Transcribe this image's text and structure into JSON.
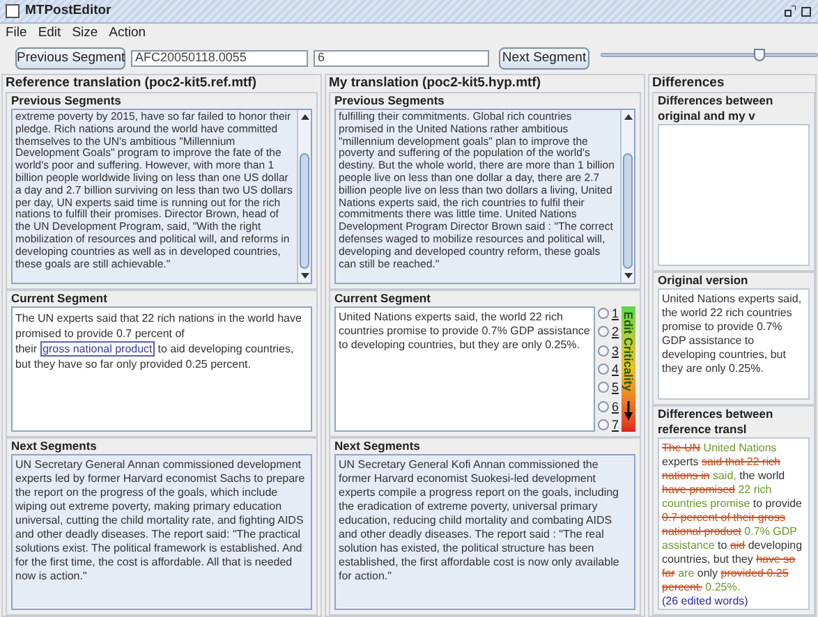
{
  "window": {
    "title": "MTPostEditor"
  },
  "menu": [
    "File",
    "Edit",
    "Size",
    "Action"
  ],
  "toolbar": {
    "previous_button": "Previous Segment",
    "document_field": "AFC20050118.0055",
    "segment_field": "6",
    "next_button": "Next Segment",
    "slider": {
      "level": 0.73
    }
  },
  "reference": {
    "title": "Reference translation (poc2-kit5.ref.mtf)",
    "previous": {
      "title": "Previous Segments",
      "text": "extreme poverty by 2015, have so far failed to honor their pledge. Rich nations around the world have committed themselves to the UN's ambitious \"Millennium Development Goals\" program to improve the fate of the world's poor and suffering. However, with more than 1 billion people worldwide living on less than one US dollar a day and 2.7 billion surviving on less than two US dollars per day, UN experts said time is running out for the rich nations to fulfill their promises. Director Brown, head of the UN Development Program, said, \"With the right mobilization of resources and political will, and reforms in developing countries as well as in developed countries, these goals are still achievable.\""
    },
    "current": {
      "title": "Current Segment",
      "parts": [
        {
          "text": "The UN experts said that 22 rich nations in the world have promised to provide 0.7 percent of their",
          "highlighted": false
        },
        {
          "text": "gross national product",
          "highlighted": true
        },
        {
          "text": "to aid developing countries, but they have so far only provided 0.25 percent.",
          "highlighted": false
        }
      ]
    },
    "next": {
      "title": "Next Segments",
      "text": "UN Secretary General Annan commissioned development experts led by former Harvard economist Sachs to prepare the report on the progress of the goals, which include wiping out extreme poverty, making primary education universal, cutting the child mortality rate, and fighting AIDS and other deadly diseases. The report said: \"The practical solutions exist. The political framework is established. And for the first time, the cost is affordable. All that is needed now is action.\""
    }
  },
  "translation": {
    "title": "My translation (poc2-kit5.hyp.mtf)",
    "previous": {
      "title": "Previous Segments",
      "text": "fulfilling their commitments. Global rich countries promised in the United Nations rather ambitious \"millennium development goals\" plan to improve the poverty and suffering of the population of the world's destiny. But the whole world, there are more than 1 billion people live on less than one dollar a day, there are 2.7 billion people live on less than two dollars a living, United Nations experts said, the rich countries to fulfil their commitments there was little time. United Nations Development Program Director Brown said : \"The correct defenses waged to mobilize resources and political will, developing and developed country reform, these goals can still be reached.\""
    },
    "current": {
      "title": "Current Segment",
      "text": "United Nations experts said, the world 22 rich countries promise to provide 0.7% GDP assistance to developing countries, but they are only 0.25%.",
      "ratings": [
        {
          "label": "1",
          "selected": false
        },
        {
          "label": "2",
          "selected": false
        },
        {
          "label": "3",
          "selected": false
        },
        {
          "label": "4",
          "selected": false
        },
        {
          "label": "5",
          "selected": false
        },
        {
          "label": "6",
          "selected": false
        },
        {
          "label": "7",
          "selected": false
        }
      ],
      "scale_label": "Edit Criticality"
    },
    "next": {
      "title": "Next Segments",
      "text": "UN Secretary General Kofi Annan commissioned the former Harvard economist Suokesi-led development experts compile a progress report on the goals, including the eradication of extreme poverty, universal primary education, reducing child mortality and combating AIDS and other deadly diseases. The report said : \"The real solution has existed, the political structure has been established, the first affordable cost is now only available for action.\""
    }
  },
  "differences": {
    "title": "Differences",
    "original_diff": {
      "title": "Differences between original and my v"
    },
    "original": {
      "title": "Original version",
      "text": "United Nations experts said, the world 22 rich countries promise to provide 0.7% GDP assistance to developing countries, but they are only 0.25%."
    },
    "reference_diff": {
      "title": "Differences between reference transl",
      "parts": [
        {
          "kind": "deleted",
          "text": "The UN"
        },
        {
          "kind": "inserted",
          "text": "United Nations"
        },
        {
          "kind": "same",
          "text": "experts"
        },
        {
          "kind": "deleted",
          "text": "said that 22 rich nations in"
        },
        {
          "kind": "inserted",
          "text": "said,"
        },
        {
          "kind": "same",
          "text": "the world"
        },
        {
          "kind": "deleted",
          "text": "have promised"
        },
        {
          "kind": "inserted",
          "text": "22 rich countries promise"
        },
        {
          "kind": "same",
          "text": "to provide"
        },
        {
          "kind": "deleted",
          "text": "0.7 percent of their gross national product"
        },
        {
          "kind": "inserted",
          "text": "0.7% GDP assistance"
        },
        {
          "kind": "same",
          "text": "to"
        },
        {
          "kind": "deleted",
          "text": "aid"
        },
        {
          "kind": "same",
          "text": "developing countries, but they"
        },
        {
          "kind": "deleted",
          "text": "have so far"
        },
        {
          "kind": "inserted",
          "text": "are"
        },
        {
          "kind": "same",
          "text": "only"
        },
        {
          "kind": "deleted",
          "text": "provided 0.25 percent."
        },
        {
          "kind": "inserted",
          "text": "0.25%."
        }
      ],
      "summary": "(26 edited words)"
    }
  }
}
